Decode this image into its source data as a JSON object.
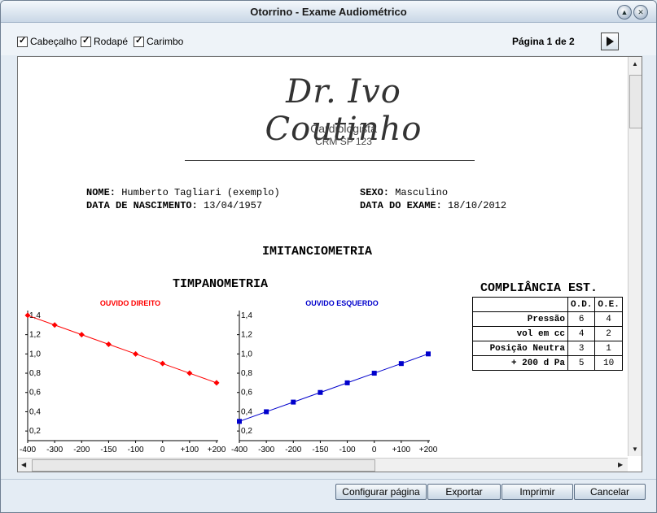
{
  "window": {
    "title": "Otorrino - Exame Audiométrico"
  },
  "toolbar": {
    "checkboxes": [
      {
        "label": "Cabeçalho",
        "checked": true
      },
      {
        "label": "Rodapé",
        "checked": true
      },
      {
        "label": "Carimbo",
        "checked": true
      }
    ],
    "page_label": "Página 1 de 2"
  },
  "document": {
    "doctor_name": "Dr. Ivo Coutinho",
    "specialty": "Cardiologista",
    "crm": "CRM SP 123",
    "patient": {
      "name_label": "NOME:",
      "name_value": "Humberto Tagliari (exemplo)",
      "sex_label": "SEXO:",
      "sex_value": "Masculino",
      "birth_label": "DATA DE NASCIMENTO:",
      "birth_value": "13/04/1957",
      "exam_label": "DATA DO EXAME:",
      "exam_value": "18/10/2012"
    },
    "section_title": "IMITANCIOMETRIA",
    "tympanometry_title": "TIMPANOMETRIA",
    "compliance": {
      "title": "COMPLIÂNCIA EST.",
      "headers": [
        "",
        "O.D.",
        "O.E."
      ],
      "rows": [
        {
          "label": "Pressão",
          "od": "6",
          "oe": "4"
        },
        {
          "label": "vol em cc",
          "od": "4",
          "oe": "2"
        },
        {
          "label": "Posição Neutra",
          "od": "3",
          "oe": "1"
        },
        {
          "label": "+ 200 d Pa",
          "od": "5",
          "oe": "10"
        }
      ]
    }
  },
  "chart_data": [
    {
      "type": "line",
      "title": "OUVIDO DIREITO",
      "color": "#ff0000",
      "marker": "diamond",
      "x": [
        -400,
        -300,
        -200,
        -150,
        -100,
        0,
        100,
        200
      ],
      "y": [
        1.4,
        1.3,
        1.2,
        1.1,
        1.0,
        0.9,
        0.8,
        0.7
      ],
      "xticks": [
        "-400",
        "-300",
        "-200",
        "-150",
        "-100",
        "0",
        "+100",
        "+200"
      ],
      "yticks": [
        "0,2",
        "0,4",
        "0,6",
        "0,8",
        "1,0",
        "1,2",
        "1,4"
      ],
      "ylim": [
        0.1,
        1.45
      ]
    },
    {
      "type": "line",
      "title": "OUVIDO ESQUERDO",
      "color": "#0000cc",
      "marker": "square",
      "x": [
        -400,
        -300,
        -200,
        -150,
        -100,
        0,
        100,
        200
      ],
      "y": [
        0.3,
        0.4,
        0.5,
        0.6,
        0.7,
        0.8,
        0.9,
        1.0
      ],
      "xticks": [
        "-400",
        "-300",
        "-200",
        "-150",
        "-100",
        "0",
        "+100",
        "+200"
      ],
      "yticks": [
        "0,2",
        "0,4",
        "0,6",
        "0,8",
        "1,0",
        "1,2",
        "1,4"
      ],
      "ylim": [
        0.1,
        1.45
      ]
    }
  ],
  "footer": {
    "buttons": [
      "Configurar página",
      "Exportar",
      "Imprimir",
      "Cancelar"
    ]
  }
}
